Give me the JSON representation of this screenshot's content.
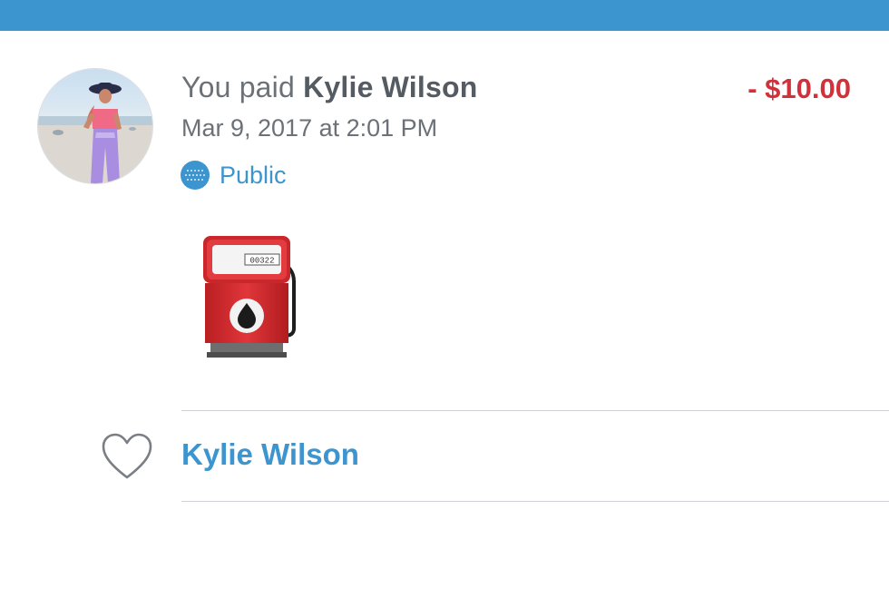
{
  "transaction": {
    "headline_prefix": "You paid ",
    "recipient": "Kylie Wilson",
    "amount": "- $10.00",
    "timestamp": "Mar 9, 2017 at 2:01 PM",
    "privacy": "Public",
    "privacy_icon": "globe-icon",
    "note_emoji": "fuel-pump-emoji",
    "pump_counter": "00322"
  },
  "likes": {
    "icon": "heart-icon",
    "liked_by": "Kylie Wilson"
  },
  "colors": {
    "header": "#3d95cf",
    "accent": "#3d95cf",
    "debit": "#d0313b",
    "text": "#6b7177"
  }
}
